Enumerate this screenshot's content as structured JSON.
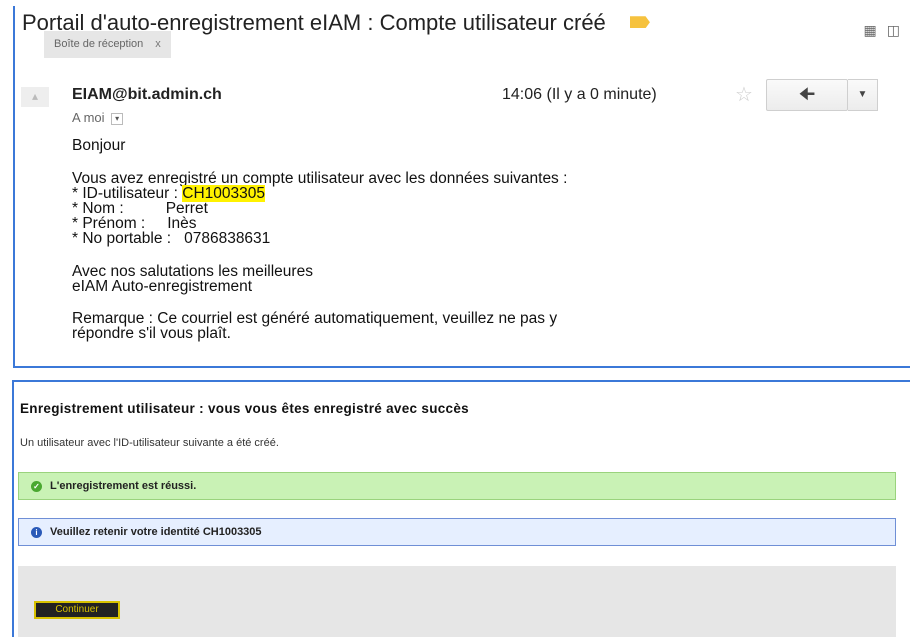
{
  "email": {
    "subject": "Portail d'auto-enregistrement eIAM : Compte utilisateur créé",
    "label_chip": "Boîte de réception",
    "label_chip_close": "x",
    "sender": "EIAM@bit.admin.ch",
    "to": "A moi",
    "time": "14:06 (Il y a 0 minute)",
    "reply_icon": "reply-arrow",
    "body": {
      "greeting": "Bonjour",
      "intro": "Vous avez enregistré un compte utilisateur avec les données suivantes :",
      "userid_label": "* ID-utilisateur : ",
      "userid_value": "CH1003305",
      "nom_label": "* Nom :",
      "nom_value": "Perret",
      "prenom_label": "* Prénom :",
      "prenom_value": "Inès",
      "mobile_label": "* No portable :",
      "mobile_value": "0786838631",
      "closing1": "Avec nos salutations les meilleures",
      "closing2": "eIAM Auto-enregistrement",
      "remark1": "Remarque : Ce courriel est généré automatiquement, veuillez ne pas y",
      "remark2": "répondre s'il vous plaît."
    }
  },
  "registration": {
    "title": "Enregistrement utilisateur : vous vous êtes enregistré avec succès",
    "subtitle": "Un utilisateur avec l'ID-utilisateur suivante a été créé.",
    "success_message": "L'enregistrement est réussi.",
    "info_message": "Veuillez retenir votre identité CH1003305",
    "continue_label": "Continuer"
  },
  "colors": {
    "highlight": "#fff200",
    "panel_border": "#3b78d8",
    "success_bg": "#c9f2b5",
    "info_bg": "#e6efff"
  }
}
